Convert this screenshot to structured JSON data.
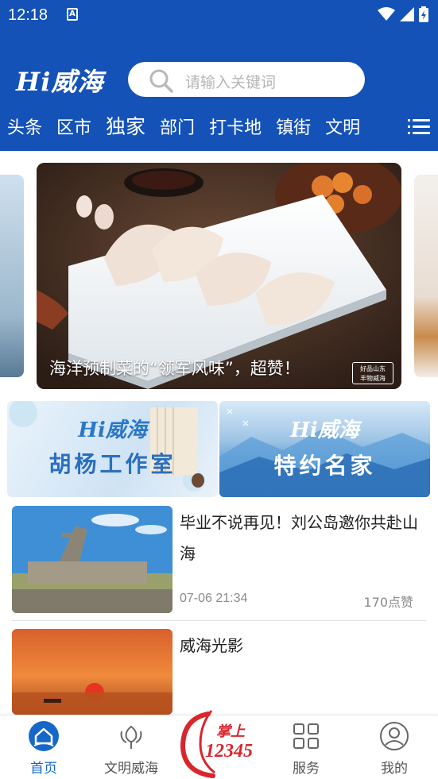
{
  "status_bar": {
    "time": "12:18",
    "notification_icon": "A"
  },
  "header": {
    "logo": "Hi威海",
    "search_placeholder": "请输入关键词"
  },
  "nav": {
    "tabs": [
      "头条",
      "区市",
      "独家",
      "部门",
      "打卡地",
      "镇街",
      "文明"
    ],
    "active": "独家"
  },
  "banner": {
    "caption": "海洋预制菜的“领军风味”，超赞！",
    "stamp_line1": "好品山东",
    "stamp_line2": "丰物威海"
  },
  "promos": [
    {
      "logo": "Hi威海",
      "title": "胡杨工作室"
    },
    {
      "logo": "Hi威海",
      "title": "特约名家"
    }
  ],
  "news": [
    {
      "title": "毕业不说再见！刘公岛邀你共赴山海",
      "time": "07-06 21:34",
      "likes": "170点赞"
    },
    {
      "title": "威海光影",
      "time": "",
      "likes": ""
    }
  ],
  "tabbar": {
    "tabs": [
      {
        "label": "首页",
        "icon": "home-icon",
        "active": true
      },
      {
        "label": "文明威海",
        "icon": "flower-icon",
        "active": false
      },
      {
        "label": "",
        "icon": "hotline-12345-logo",
        "active": false
      },
      {
        "label": "服务",
        "icon": "grid-icon",
        "active": false
      },
      {
        "label": "我的",
        "icon": "person-icon",
        "active": false
      }
    ],
    "center_logo": {
      "line1": "掌上",
      "line2": "12345"
    }
  },
  "colors": {
    "header_bg": "#1452b8",
    "active_tab": "#1667c8",
    "hotline_red": "#d9252b"
  }
}
